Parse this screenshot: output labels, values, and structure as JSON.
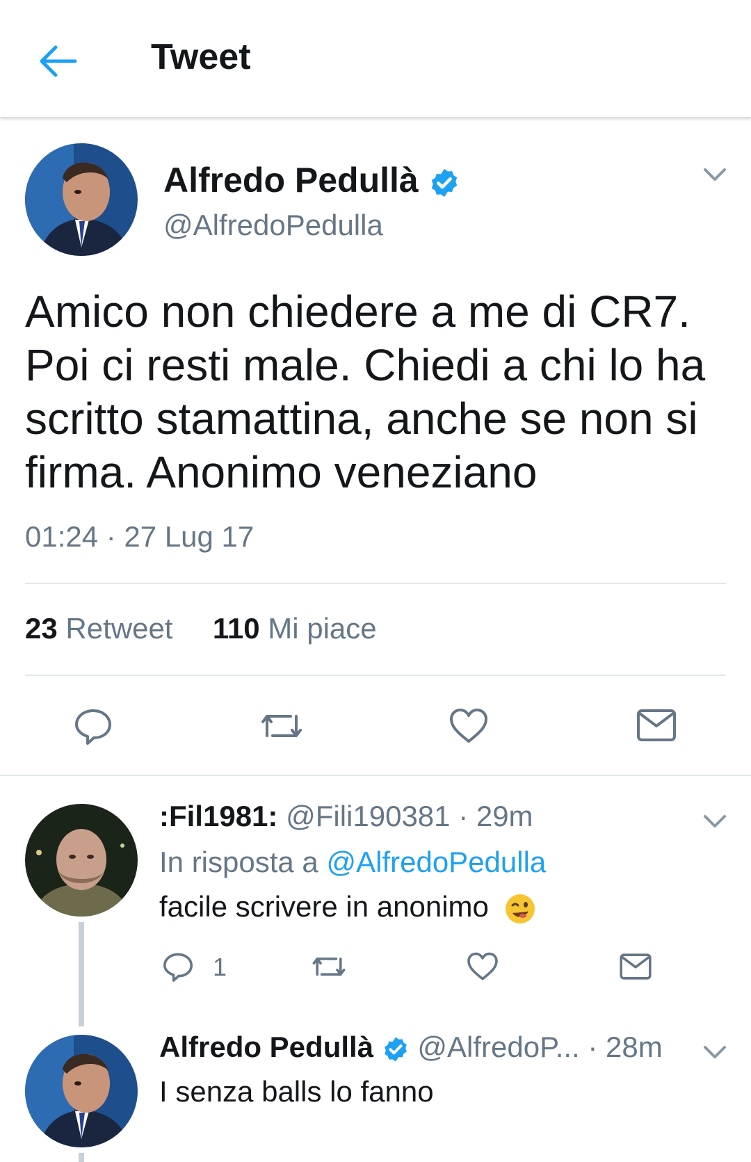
{
  "header": {
    "title": "Tweet",
    "back_icon": "arrow-left-icon"
  },
  "colors": {
    "accent": "#1da1f2",
    "text": "#14171a",
    "muted": "#657786",
    "divider": "#e1e8ed"
  },
  "tweet": {
    "author_name": "Alfredo Pedullà",
    "author_handle": "@AlfredoPedulla",
    "verified": true,
    "text": "Amico non chiedere a me di CR7. Poi ci resti male. Chiedi a chi lo ha scritto stamattina, anche se non si firma. Anonimo veneziano",
    "timestamp": "01:24 · 27 Lug 17",
    "retweet_count": "23",
    "retweet_label": "Retweet",
    "like_count": "110",
    "like_label": "Mi piace"
  },
  "replies": [
    {
      "author_name": ":Fil1981:",
      "author_handle": "@Fili190381",
      "time": "· 29m",
      "reply_to_label": "In risposta a",
      "reply_to_handle": "@AlfredoPedulla",
      "text": "facile scrivere in anonimo",
      "emoji": "winking-face",
      "reply_count": "1"
    },
    {
      "author_name": "Alfredo Pedullà",
      "author_handle": "@AlfredoP...",
      "time": "· 28m",
      "verified": true,
      "text": "I senza balls lo fanno"
    }
  ]
}
